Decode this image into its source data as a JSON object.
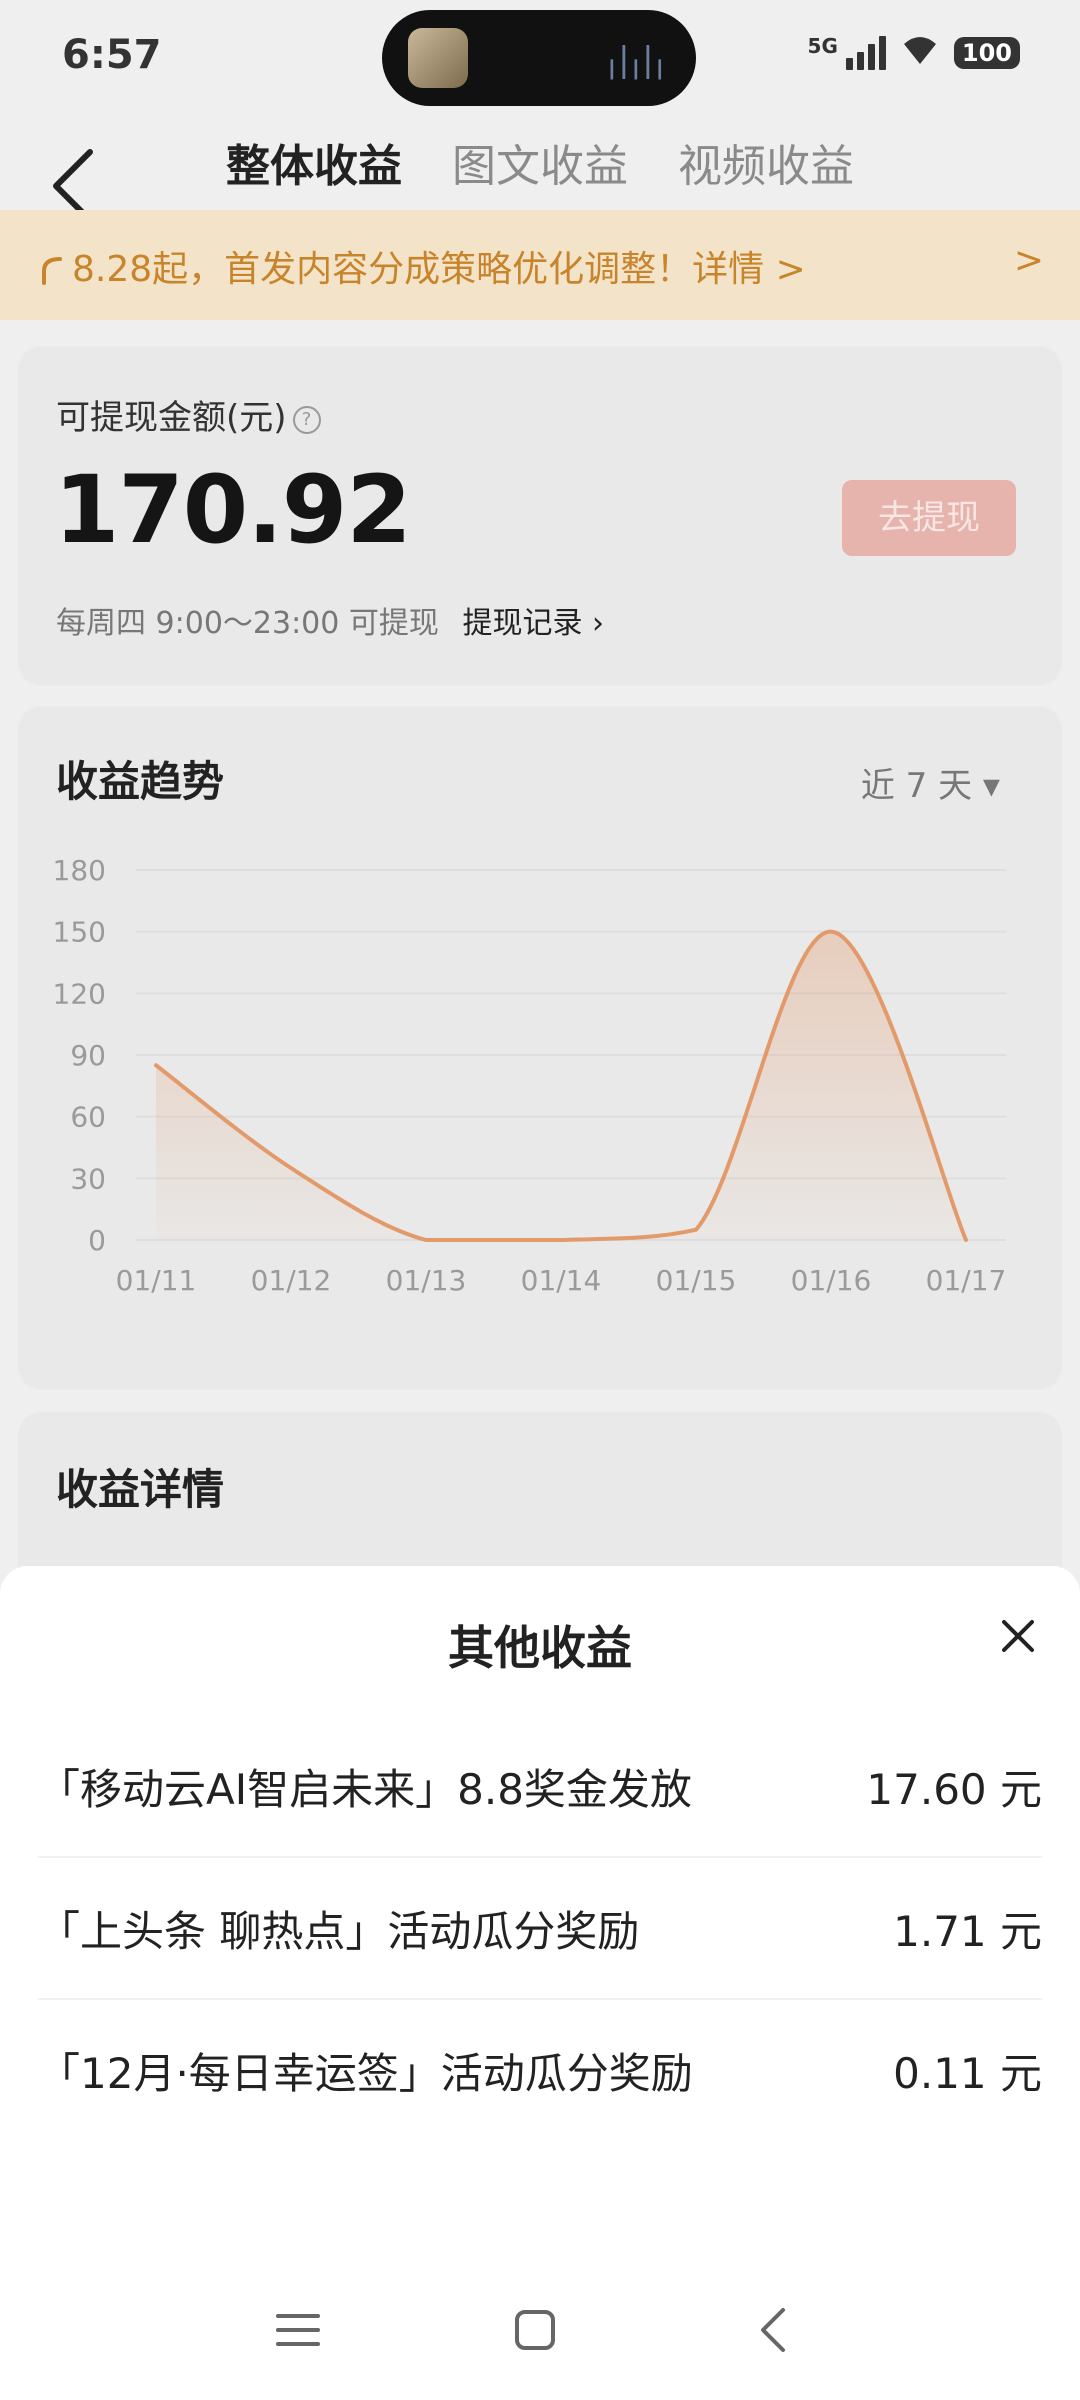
{
  "status": {
    "time": "6:57",
    "network": "5G",
    "battery": "100"
  },
  "nav": {
    "tabs": [
      {
        "label": "整体收益",
        "active": true
      },
      {
        "label": "图文收益",
        "active": false
      },
      {
        "label": "视频收益",
        "active": false
      }
    ]
  },
  "notice": {
    "text": "8.28起，首发内容分成策略优化调整！详情 >",
    "arrow": ">"
  },
  "balance": {
    "label": "可提现金额(元)",
    "help_glyph": "?",
    "amount": "170.92",
    "withdraw_label": "去提现",
    "schedule": "每周四 9:00～23:00 可提现",
    "record_label": "提现记录 ›"
  },
  "trend": {
    "title": "收益趋势",
    "range_label": "近 7 天 ▾"
  },
  "chart_data": {
    "type": "line",
    "x": [
      "01/11",
      "01/12",
      "01/13",
      "01/14",
      "01/15",
      "01/16",
      "01/17"
    ],
    "series": [
      {
        "values": [
          85,
          35,
          0,
          0,
          5,
          150,
          0
        ]
      }
    ],
    "ylim": [
      0,
      180
    ],
    "yticks": [
      0,
      30,
      60,
      90,
      120,
      150,
      180
    ],
    "grid": true,
    "color": "#e39a6a"
  },
  "detail": {
    "title": "收益详情"
  },
  "sheet": {
    "title": "其他收益",
    "items": [
      {
        "name": "「移动云AI智启未来」8.8奖金发放",
        "value": "17.60 元"
      },
      {
        "name": "「上头条 聊热点」活动瓜分奖励",
        "value": "1.71 元"
      },
      {
        "name": "「12月·每日幸运签」活动瓜分奖励",
        "value": "0.11 元"
      }
    ]
  }
}
